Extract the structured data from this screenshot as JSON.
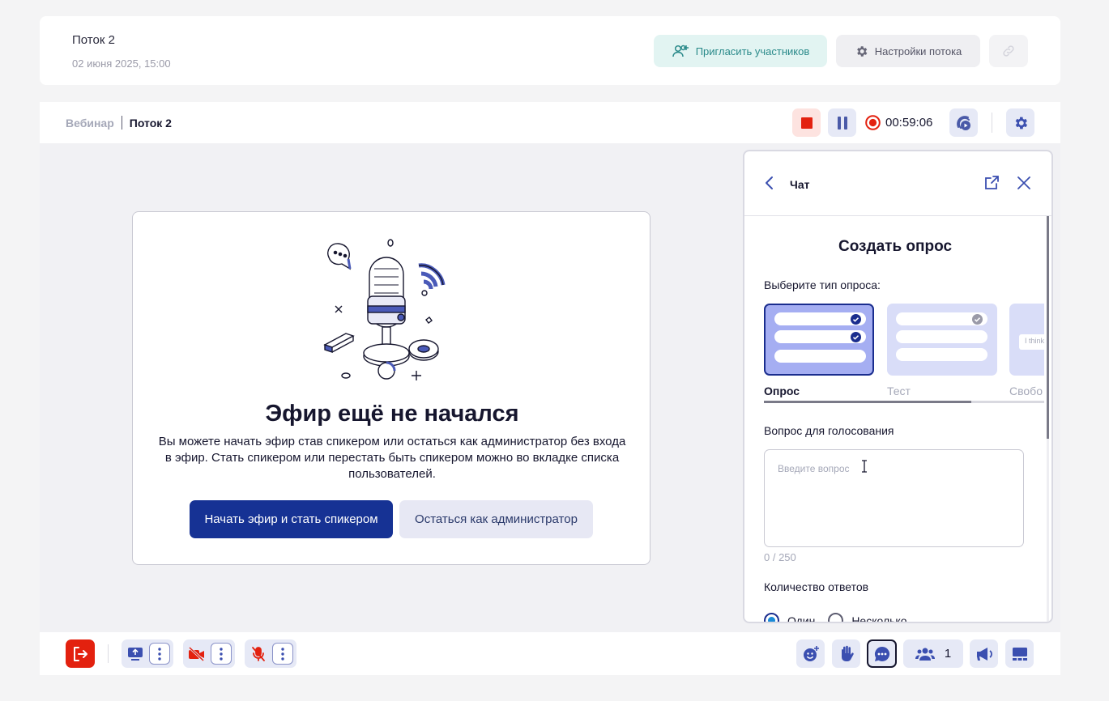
{
  "header": {
    "stream_title": "Поток 2",
    "stream_date": "02 июня 2025, 15:00",
    "invite_label": "Пригласить участников",
    "settings_label": "Настройки потока"
  },
  "toolbar": {
    "breadcrumb_root": "Вебинар",
    "breadcrumb_current": "Поток 2",
    "timer": "00:59:06"
  },
  "empty_state": {
    "title": "Эфир ещё не начался",
    "description": "Вы можете начать эфир став спикером или остаться как администратор без входа в эфир. Стать спикером или перестать быть спикером можно во вкладке списка пользователей.",
    "start_label": "Начать эфир и стать спикером",
    "admin_label": "Остаться как администратор"
  },
  "panel": {
    "title": "Чат",
    "heading": "Создать опрос",
    "type_label": "Выберите тип опроса:",
    "types": [
      {
        "name": "Опрос",
        "active": true
      },
      {
        "name": "Тест",
        "active": false
      },
      {
        "name": "Свобо",
        "active": false
      }
    ],
    "free_preview_text": "I think",
    "question_label": "Вопрос для голосования",
    "question_placeholder": "Введите вопрос",
    "question_value": "",
    "char_count": "0 / 250",
    "answers_label": "Количество ответов",
    "answer_options": [
      "Один",
      "Несколько"
    ]
  },
  "bottom_bar": {
    "participants_count": "1"
  },
  "colors": {
    "primary": "#163294",
    "accent_light": "#e6e9f6",
    "danger": "#e3210f",
    "invite_bg": "#e2f4f2"
  }
}
